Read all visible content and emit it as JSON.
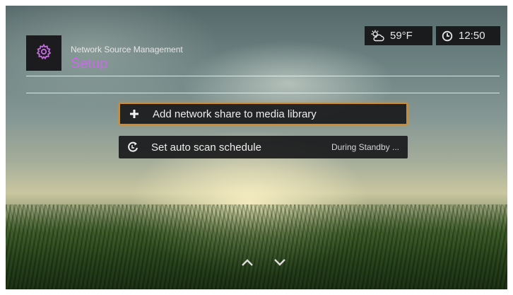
{
  "header": {
    "section": "Network Source Management",
    "title": "Setup",
    "icon": "gear-icon"
  },
  "status": {
    "weather_icon": "sun-cloud-icon",
    "temperature": "59°F",
    "clock_icon": "clock-icon",
    "time": "12:50"
  },
  "menu": {
    "items": [
      {
        "icon": "plus-icon",
        "label": "Add network share to media library",
        "value": "",
        "selected": true
      },
      {
        "icon": "refresh-icon",
        "label": "Set auto scan schedule",
        "value": "During Standby ...",
        "selected": false
      }
    ]
  },
  "navigation": {
    "up_icon": "chevron-up-icon",
    "down_icon": "chevron-down-icon"
  },
  "colors": {
    "accent_title": "#c86ce6",
    "selection_border": "#d08a2c",
    "panel_bg": "#1c1c1e"
  }
}
